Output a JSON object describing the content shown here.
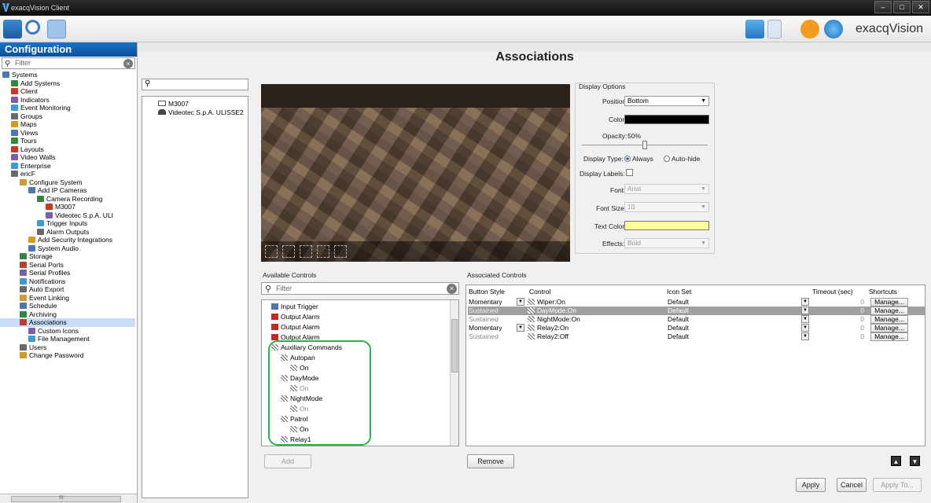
{
  "window": {
    "title": "exacqVision Client"
  },
  "toolbar": {
    "brand": "exacqVision",
    "icons": [
      "live-view-icon",
      "search-icon",
      "setup-icon",
      "fullscreen-icon",
      "layout-icon",
      "alert-icon",
      "help-icon"
    ]
  },
  "sidebar": {
    "header": "Configuration",
    "filter_placeholder": "Filter",
    "tree": [
      {
        "label": "Systems",
        "level": 0,
        "icon": "systems-icon"
      },
      {
        "label": "Add Systems",
        "level": 1,
        "icon": "add-systems-icon"
      },
      {
        "label": "Client",
        "level": 1,
        "icon": "client-icon"
      },
      {
        "label": "Indicators",
        "level": 1,
        "icon": "indicators-icon"
      },
      {
        "label": "Event Monitoring",
        "level": 1,
        "icon": "event-monitoring-icon"
      },
      {
        "label": "Groups",
        "level": 1,
        "icon": "groups-icon"
      },
      {
        "label": "Maps",
        "level": 1,
        "icon": "maps-icon"
      },
      {
        "label": "Views",
        "level": 1,
        "icon": "views-icon"
      },
      {
        "label": "Tours",
        "level": 1,
        "icon": "tours-icon"
      },
      {
        "label": "Layouts",
        "level": 1,
        "icon": "layouts-icon"
      },
      {
        "label": "Video Walls",
        "level": 1,
        "icon": "video-walls-icon"
      },
      {
        "label": "Enterprise",
        "level": 1,
        "icon": "enterprise-icon"
      },
      {
        "label": "ericF",
        "level": 1,
        "icon": "server-icon"
      },
      {
        "label": "Configure System",
        "level": 2,
        "icon": "configure-system-icon"
      },
      {
        "label": "Add IP Cameras",
        "level": 3,
        "icon": "add-ip-cameras-icon"
      },
      {
        "label": "Camera Recording",
        "level": 4,
        "icon": "camera-recording-icon"
      },
      {
        "label": "M3007",
        "level": 5,
        "icon": "camera-icon"
      },
      {
        "label": "Videotec S.p.A. ULI",
        "level": 5,
        "icon": "ptz-camera-icon"
      },
      {
        "label": "Trigger Inputs",
        "level": 4,
        "icon": "trigger-inputs-icon"
      },
      {
        "label": "Alarm Outputs",
        "level": 4,
        "icon": "alarm-outputs-icon"
      },
      {
        "label": "Add Security Integrations",
        "level": 3,
        "icon": "security-integrations-icon"
      },
      {
        "label": "System Audio",
        "level": 3,
        "icon": "audio-icon"
      },
      {
        "label": "Storage",
        "level": 2,
        "icon": "storage-icon"
      },
      {
        "label": "Serial Ports",
        "level": 2,
        "icon": "serial-ports-icon"
      },
      {
        "label": "Serial Profiles",
        "level": 2,
        "icon": "serial-profiles-icon"
      },
      {
        "label": "Notifications",
        "level": 2,
        "icon": "notifications-icon"
      },
      {
        "label": "Auto Export",
        "level": 2,
        "icon": "auto-export-icon"
      },
      {
        "label": "Event Linking",
        "level": 2,
        "icon": "event-linking-icon"
      },
      {
        "label": "Schedule",
        "level": 2,
        "icon": "schedule-icon"
      },
      {
        "label": "Archiving",
        "level": 2,
        "icon": "archiving-icon"
      },
      {
        "label": "Associations",
        "level": 2,
        "icon": "associations-icon",
        "selected": true
      },
      {
        "label": "Custom Icons",
        "level": 3,
        "icon": "custom-icons-icon"
      },
      {
        "label": "File Management",
        "level": 3,
        "icon": "file-management-icon"
      },
      {
        "label": "Users",
        "level": 2,
        "icon": "users-icon"
      },
      {
        "label": "Change Password",
        "level": 2,
        "icon": "change-password-icon"
      }
    ],
    "hscroll_glyph": "III"
  },
  "page": {
    "title": "Associations"
  },
  "cameras": [
    "M3007",
    "Videotec S.p.A. ULISSE2"
  ],
  "display_options": {
    "heading": "Display Options",
    "position_label": "Position:",
    "position_value": "Bottom",
    "color_label": "Color:",
    "color_value": "#000000",
    "opacity_label": "Opacity:",
    "opacity_value": "50%",
    "opacity_fraction": 0.5,
    "display_type_label": "Display Type:",
    "display_type_always": "Always",
    "display_type_autohide": "Auto-hide",
    "display_labels_label": "Display Labels:",
    "font_label": "Font:",
    "font_value": "Arial",
    "font_size_label": "Font Size:",
    "font_size_value": "10",
    "text_color_label": "Text Color:",
    "text_color_value": "#ffff99",
    "effects_label": "Effects:",
    "effects_value": "Bold"
  },
  "available": {
    "heading": "Available Controls",
    "filter_placeholder": "Filter",
    "items": [
      {
        "label": "Input Trigger",
        "indent": 0,
        "icon": "input-trigger-icon"
      },
      {
        "label": "Output Alarm",
        "indent": 0,
        "icon": "output-alarm-icon"
      },
      {
        "label": "Output Alarm",
        "indent": 0,
        "icon": "output-alarm-icon"
      },
      {
        "label": "Output Alarm",
        "indent": 0,
        "icon": "output-alarm-icon"
      },
      {
        "label": "Auxiliary Commands",
        "indent": 0,
        "icon": "auxiliary-icon"
      },
      {
        "label": "Autopan",
        "indent": 1,
        "icon": "auxiliary-icon"
      },
      {
        "label": "On",
        "indent": 2,
        "icon": "auxiliary-icon"
      },
      {
        "label": "DayMode",
        "indent": 1,
        "icon": "auxiliary-icon"
      },
      {
        "label": "On",
        "indent": 2,
        "icon": "auxiliary-icon",
        "dim": true
      },
      {
        "label": "NightMode",
        "indent": 1,
        "icon": "auxiliary-icon"
      },
      {
        "label": "On",
        "indent": 2,
        "icon": "auxiliary-icon",
        "dim": true
      },
      {
        "label": "Patrol",
        "indent": 1,
        "icon": "auxiliary-icon"
      },
      {
        "label": "On",
        "indent": 2,
        "icon": "auxiliary-icon"
      },
      {
        "label": "Relay1",
        "indent": 1,
        "icon": "auxiliary-icon"
      }
    ],
    "add_label": "Add"
  },
  "associated": {
    "heading": "Associated Controls",
    "columns": [
      "Button Style",
      "Control",
      "Icon Set",
      "Timeout (sec)",
      "Shortcuts"
    ],
    "rows": [
      {
        "style": "Momentary",
        "control": "Wiper:On",
        "iconset": "Default",
        "timeout": "0",
        "shortcut": "Manage...",
        "has_dropdown": true
      },
      {
        "style": "Sustained",
        "control": "DayMode:On",
        "iconset": "Default",
        "timeout": "0",
        "shortcut": "Manage...",
        "selected": true
      },
      {
        "style": "Sustained",
        "control": "NightMode:On",
        "iconset": "Default",
        "timeout": "0",
        "shortcut": "Manage..."
      },
      {
        "style": "Momentary",
        "control": "Relay2:On",
        "iconset": "Default",
        "timeout": "0",
        "shortcut": "Manage...",
        "has_dropdown": true
      },
      {
        "style": "Sustained",
        "control": "Relay2:Off",
        "iconset": "Default",
        "timeout": "0",
        "shortcut": "Manage..."
      }
    ],
    "remove_label": "Remove"
  },
  "footer": {
    "apply": "Apply",
    "cancel": "Cancel",
    "apply_to": "Apply To..."
  },
  "colors": {
    "accent": "#0a5fb4",
    "highlight": "#2fb04a",
    "selected_row": "#a0a0a0"
  }
}
